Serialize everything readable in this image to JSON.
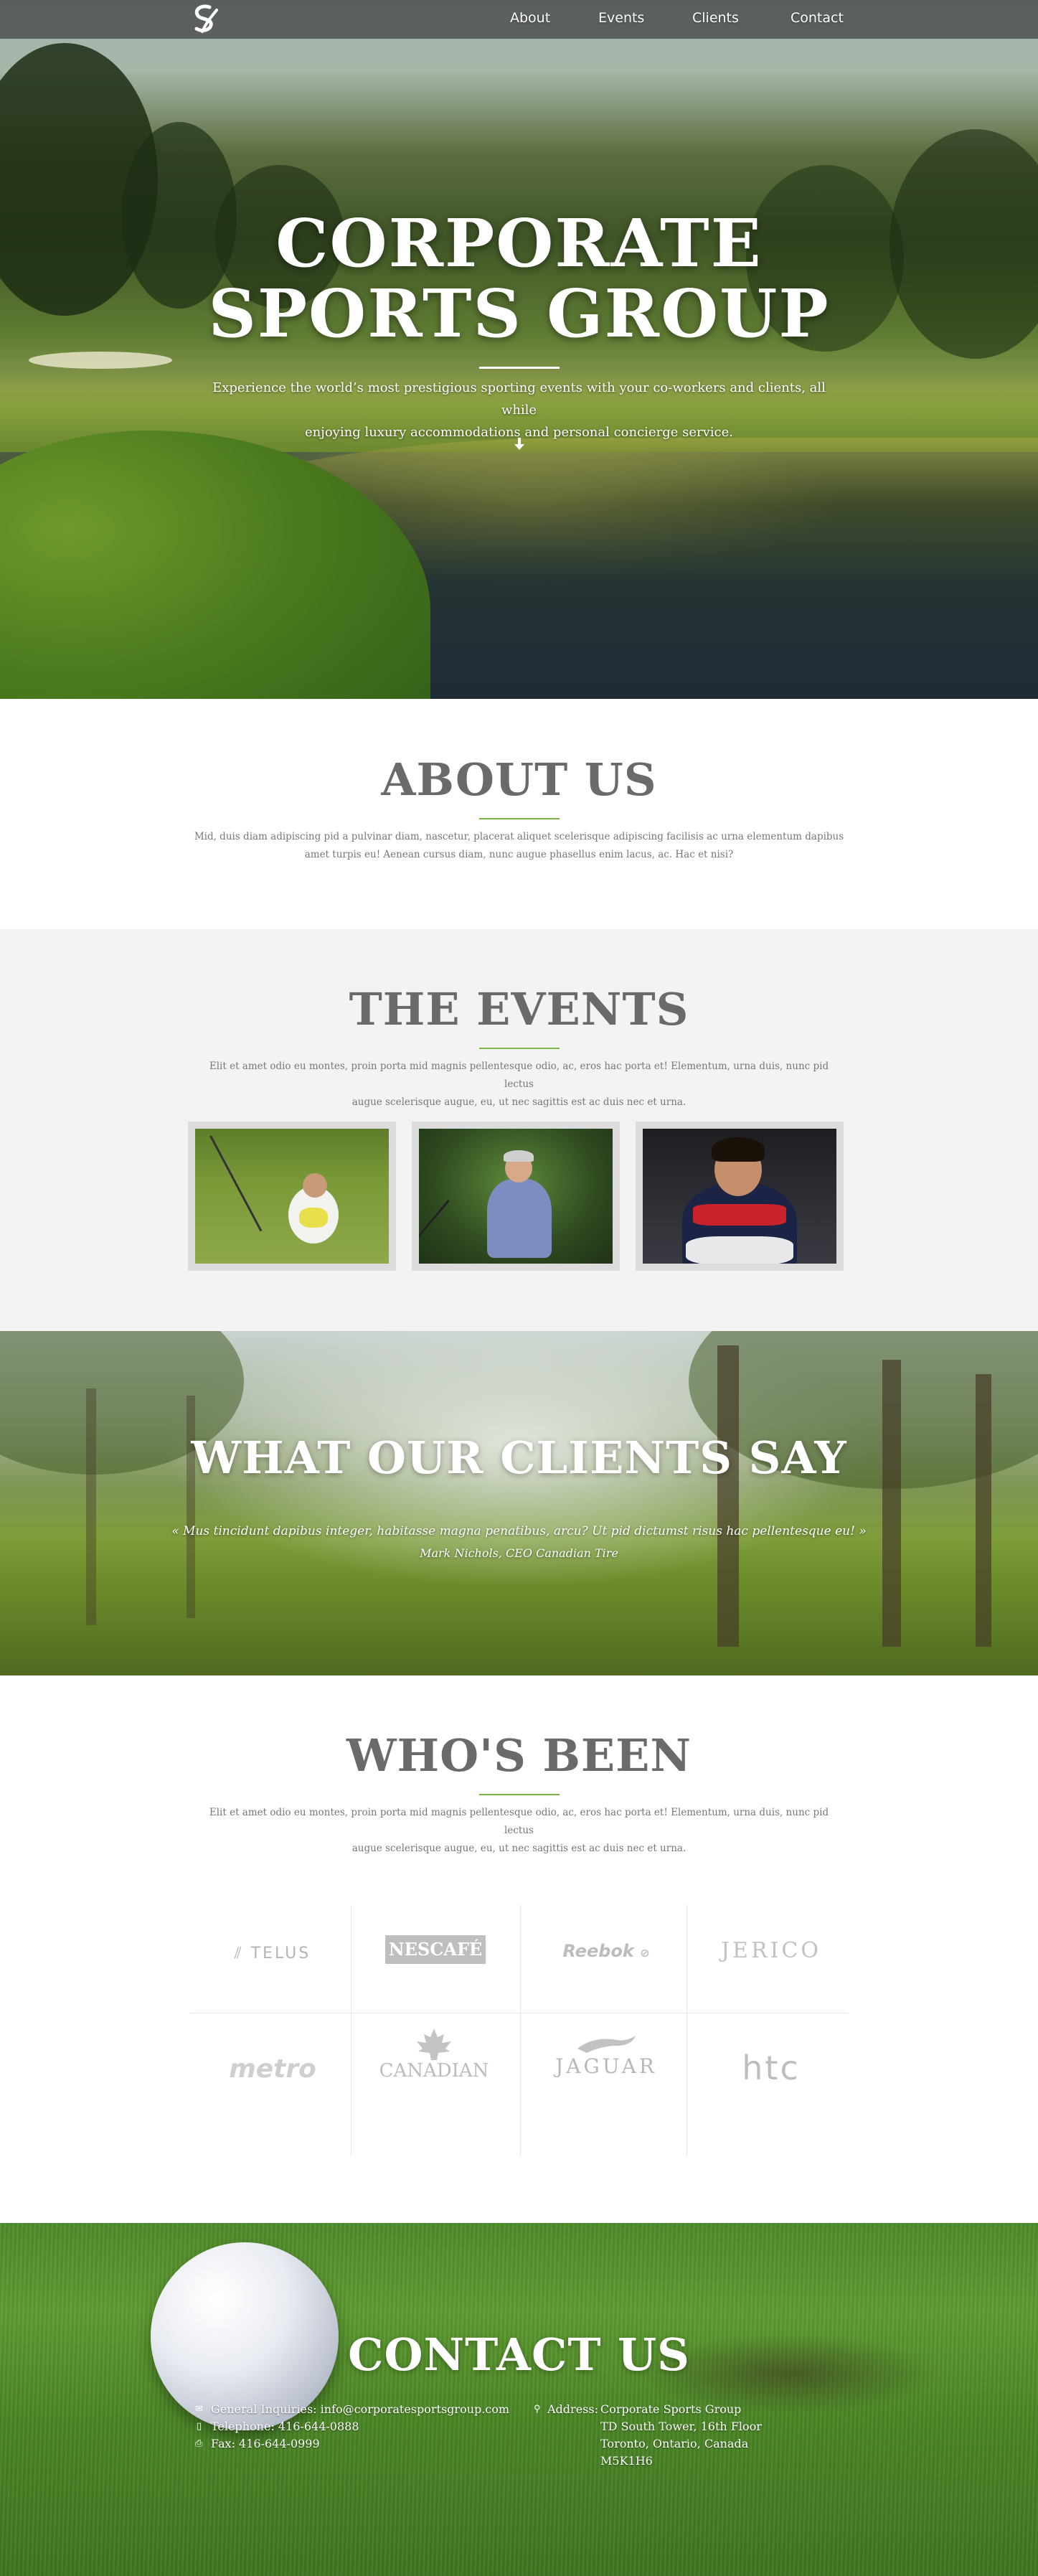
{
  "nav": {
    "items": [
      {
        "label": "About"
      },
      {
        "label": "Events"
      },
      {
        "label": "Clients"
      },
      {
        "label": "Contact"
      }
    ]
  },
  "hero": {
    "title_line1": "CORPORATE",
    "title_line2": "SPORTS GROUP",
    "tagline_line1": "Experience the world’s most prestigious sporting events with your co-workers and clients, all while",
    "tagline_line2": "enjoying luxury accommodations and personal concierge service."
  },
  "about": {
    "title": "ABOUT US",
    "text_line1": "Mid, duis diam adipiscing pid a pulvinar diam, nascetur, placerat aliquet scelerisque adipiscing facilisis ac urna elementum dapibus",
    "text_line2": "amet turpis eu! Aenean cursus diam, nunc augue phasellus enim lacus, ac. Hac et nisi?"
  },
  "events": {
    "title": "THE EVENTS",
    "text_line1": "Elit et amet odio eu montes, proin porta mid magnis pellentesque odio, ac, eros hac porta et! Elementum, urna duis, nunc pid lectus",
    "text_line2": "augue scelerisque augue, eu, ut nec sagittis est ac duis nec et urna."
  },
  "clients": {
    "title": "WHAT OUR CLIENTS SAY",
    "quote": "« Mus tincidunt dapibus integer, habitasse magna penatibus, arcu? Ut pid dictumst risus hac pellentesque eu! »",
    "author": "Mark Nichols, CEO Canadian Tire"
  },
  "whos_been": {
    "title": "WHO'S BEEN",
    "text_line1": "Elit et amet odio eu montes, proin porta mid magnis pellentesque odio, ac, eros hac porta et! Elementum, urna duis, nunc pid lectus",
    "text_line2": "augue scelerisque augue, eu, ut nec sagittis est ac duis nec et urna.",
    "brands": [
      "TELUS",
      "NESCAFÉ",
      "Reebok",
      "JERICO",
      "metro",
      "CANADIAN",
      "JAGUAR",
      "htc"
    ]
  },
  "contact": {
    "title": "CONTACT US",
    "general": "General Inquiries: info@corporatesportsgroup.com",
    "telephone": "Telephone: 416-644-0888",
    "fax": "Fax: 416-644-0999",
    "address_label": "Address:",
    "address_line1": "Corporate Sports Group",
    "address_line2": "TD South Tower, 16th Floor",
    "address_line3": "Toronto, Ontario, Canada",
    "address_line4": "M5K1H6"
  },
  "colors": {
    "accent_green": "#7db544",
    "heading_gray": "#6a6a6a",
    "events_bg": "#f3f3f3"
  }
}
